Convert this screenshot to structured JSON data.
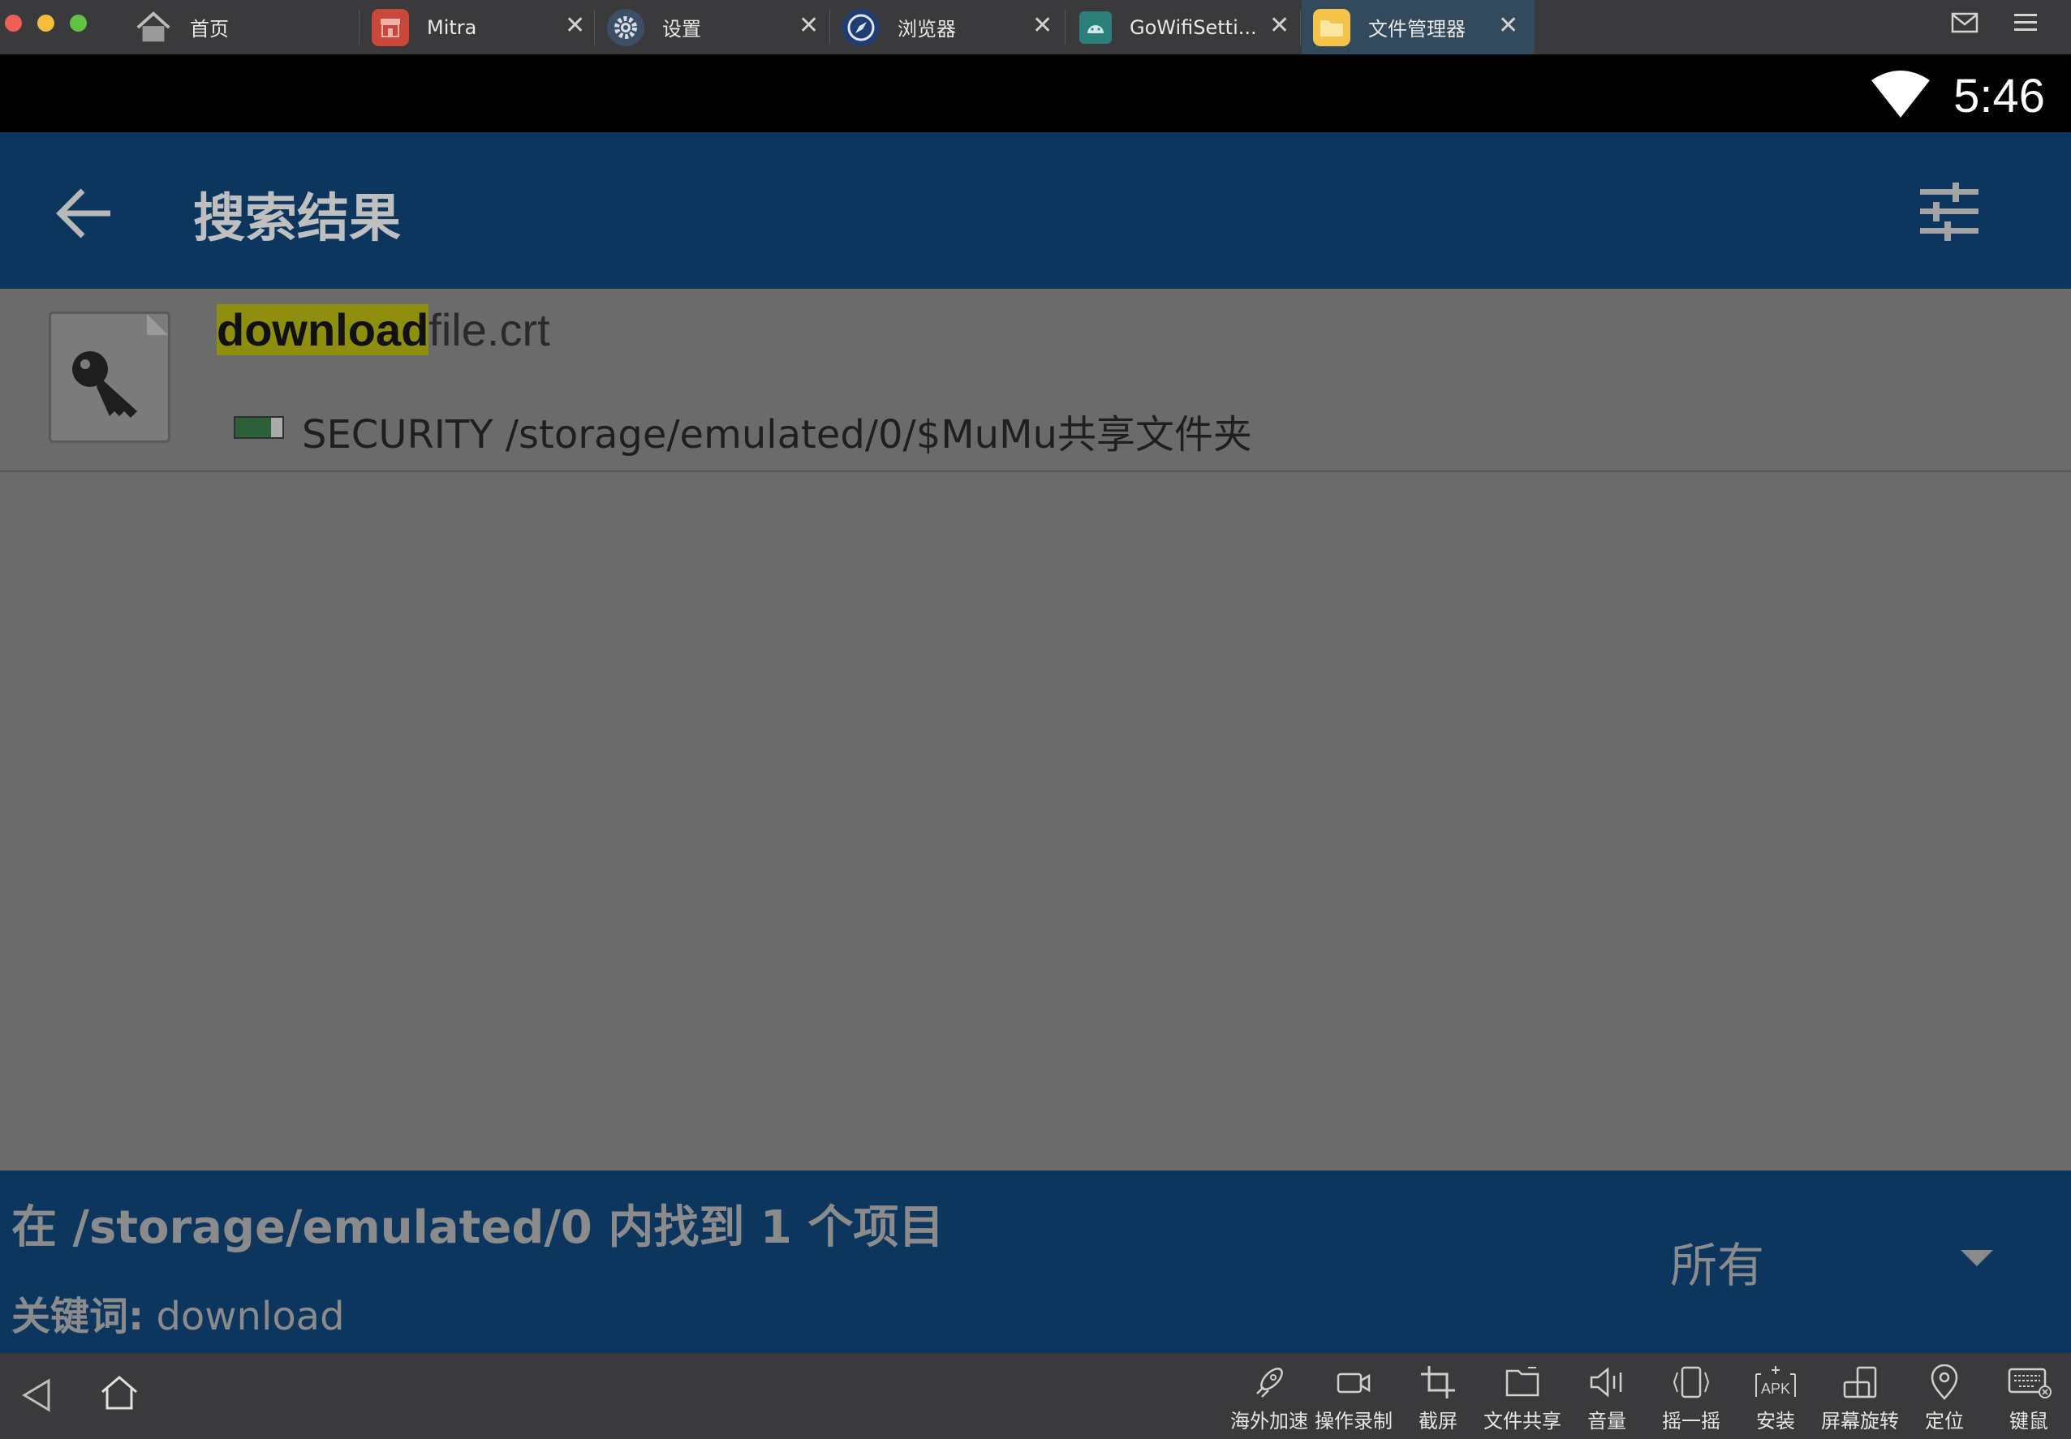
{
  "tabs": [
    {
      "label": "首页",
      "icon": "home-icon"
    },
    {
      "label": "Mitra",
      "icon": "store-icon"
    },
    {
      "label": "设置",
      "icon": "gear-icon"
    },
    {
      "label": "浏览器",
      "icon": "compass-icon"
    },
    {
      "label": "GoWifiSetti...",
      "icon": "android-icon"
    },
    {
      "label": "文件管理器",
      "icon": "folder-icon",
      "active": true
    }
  ],
  "titlebar_right": {
    "mail_icon": "mail-icon",
    "menu_icon": "menu-icon"
  },
  "status": {
    "time": "5:46"
  },
  "appbar": {
    "title": "搜索结果"
  },
  "result": {
    "highlight": "download",
    "name_rest": "file.crt",
    "path": "SECURITY /storage/emulated/0/$MuMu共享文件夹"
  },
  "info": {
    "found_text": "在 /storage/emulated/0 内找到 1 个项目",
    "keyword_label": "关键词:",
    "keyword_value": " download",
    "filter_value": "所有"
  },
  "toolbar": {
    "tools": [
      {
        "label": "海外加速",
        "icon": "rocket-icon"
      },
      {
        "label": "操作录制",
        "icon": "video-icon"
      },
      {
        "label": "截屏",
        "icon": "crop-icon"
      },
      {
        "label": "文件共享",
        "icon": "folder-share-icon"
      },
      {
        "label": "音量",
        "icon": "volume-icon"
      },
      {
        "label": "摇一摇",
        "icon": "shake-icon"
      },
      {
        "label": "安装",
        "icon": "apk-icon"
      },
      {
        "label": "屏幕旋转",
        "icon": "rotate-icon"
      },
      {
        "label": "定位",
        "icon": "location-icon"
      },
      {
        "label": "键鼠",
        "icon": "keyboard-icon"
      }
    ]
  },
  "colors": {
    "appbar": "#0d365e",
    "content": "#6b6b6b",
    "highlight": "#8e8e0f",
    "tabbar": "#3a3a3c"
  }
}
